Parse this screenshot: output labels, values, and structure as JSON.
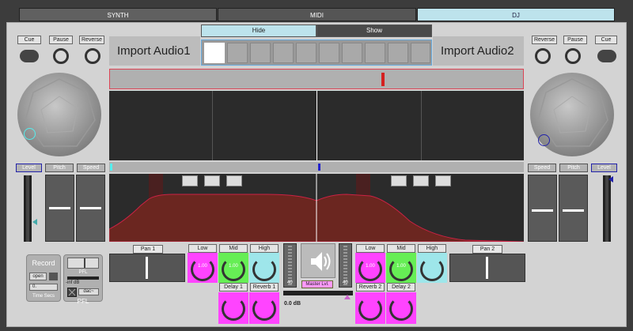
{
  "tabs": [
    {
      "label": "SYNTH"
    },
    {
      "label": "MIDI"
    },
    {
      "label": "DJ"
    }
  ],
  "deck_left": {
    "buttons": [
      "Cue",
      "Pause",
      "Reverse"
    ],
    "title": "Import Audio1",
    "controls": [
      "Level",
      "Pitch",
      "Speed"
    ]
  },
  "deck_right": {
    "buttons": [
      "Reverse",
      "Pause",
      "Cue"
    ],
    "title": "Import Audio2",
    "controls": [
      "Speed",
      "Pitch",
      "Level"
    ]
  },
  "view_toggle": {
    "hide": "Hide",
    "show": "Show"
  },
  "mixer": {
    "pan1": "Pan 1",
    "pan2": "Pan 2",
    "eq_left": [
      "Low",
      "Mid",
      "High"
    ],
    "eq_right": [
      "Low",
      "Mid",
      "High"
    ],
    "eq_values": [
      "1.00",
      "1.00",
      "1.00",
      "1.00"
    ],
    "fx_left": [
      "Delay 1",
      "Reverb 1"
    ],
    "fx_right": [
      "Reverb 2",
      "Delay 2"
    ],
    "master": "Master Lvl.",
    "fader_values": [
      "40",
      "40"
    ],
    "master_db": "0.0 dB"
  },
  "record": {
    "title": "Record",
    "open": "open",
    "time_value": "0.",
    "time_label": "Time Secs"
  },
  "pfl": {
    "header": "PFL",
    "level": "-inf dB",
    "dac": "dac~",
    "label": "PFL"
  },
  "colors": {
    "accent_blue": "#bde3ec",
    "magenta": "#ff44ff",
    "green": "#66ee55",
    "cyan": "#9ee6ea",
    "waveform": "#8b2b22"
  }
}
